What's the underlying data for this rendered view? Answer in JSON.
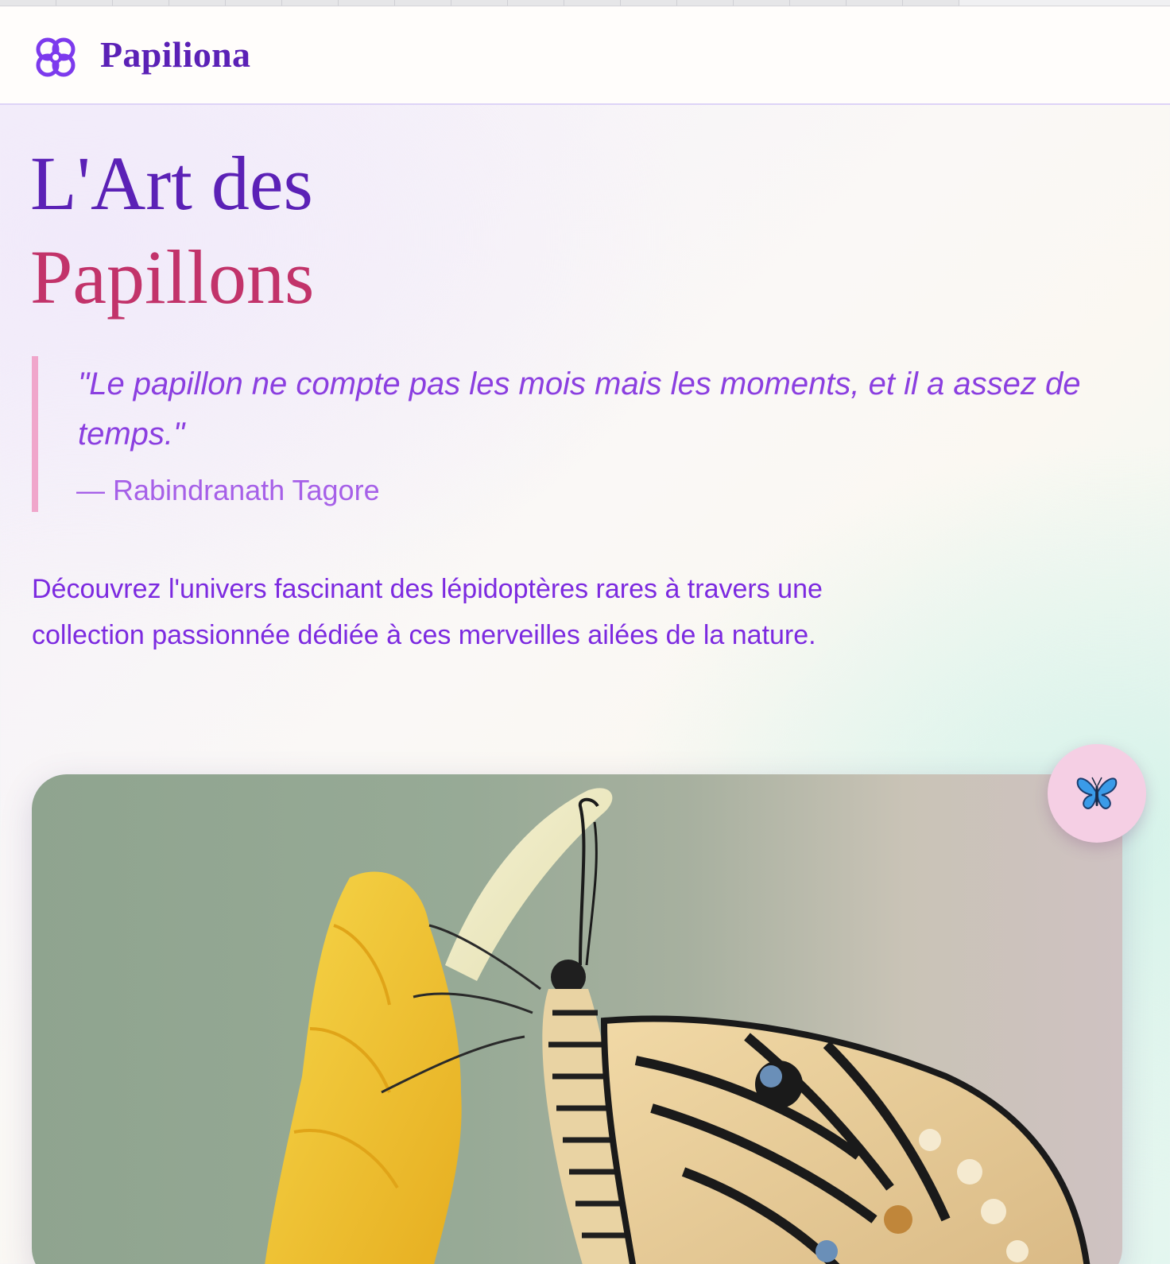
{
  "header": {
    "brand_name": "Papiliona",
    "logo_icon": "flower-icon"
  },
  "hero": {
    "title_line1": "L'Art des",
    "title_line2": "Papillons",
    "quote": "\"Le papillon ne compte pas les mois mais les moments, et il a assez de temps.\"",
    "quote_author": "— Rabindranath Tagore",
    "intro": "Découvrez l'univers fascinant des lépidoptères rares à travers une collection passionnée dédiée à ces merveilles ailées de la nature.",
    "image_subject": "butterfly-on-yellow-flower-photo"
  },
  "fab": {
    "icon": "butterfly-icon"
  },
  "colors": {
    "primary": "#5b21b6",
    "accent_pink": "#c2336a",
    "quote_border": "#f0a6cb",
    "text_purple": "#7c2ae0",
    "fab_bg": "#f5cfe4"
  }
}
